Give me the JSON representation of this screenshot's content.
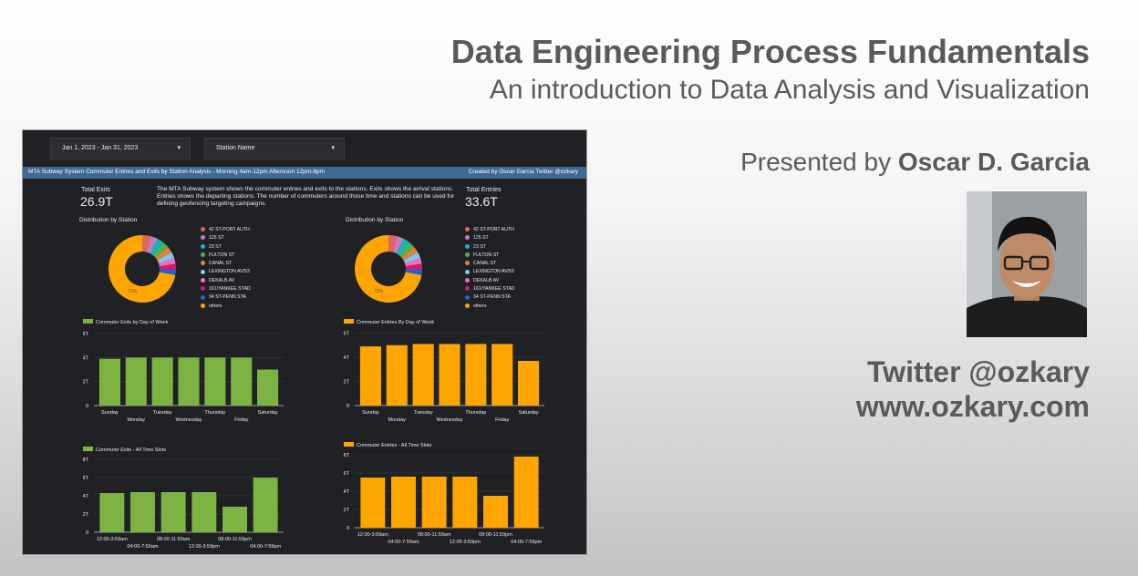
{
  "slide": {
    "title": "Data Engineering Process Fundamentals",
    "subtitle": "An introduction to Data Analysis and Visualization",
    "presented_prefix": "Presented by",
    "presenter": "Oscar D. Garcia",
    "twitter": "Twitter @ozkary",
    "website": "www.ozkary.com"
  },
  "dashboard": {
    "date_filter": "Jan 1, 2023 - Jan 31, 2023",
    "station_filter": "Station Name",
    "dropdown_arrow": "▾",
    "banner_left": "MTA Subway System Commuter Entries and Exits by Station Analysis  -  Morning 4am-12pm Afternoon 12pm-8pm",
    "banner_right": "Created by Oscar Garcia Twitter @ozkary",
    "exits_label": "Total Exits",
    "exits_value": "26.9T",
    "entries_label": "Total Entries",
    "entries_value": "33.6T",
    "description": "The MTA Subway system shows the commuter entries and exits to the stations. Exits shows the arrival stations. Entries shows the departing stations. The number of commuters around those time and stations can be used for defining geofencing targeting campaigns.",
    "distribution_title_left": "Distribution by Station",
    "distribution_title_right": "Distribution by Station",
    "stations": [
      {
        "name": "42 ST-PORT AUTH",
        "color": "#d86b5b"
      },
      {
        "name": "125 ST",
        "color": "#cc79c0"
      },
      {
        "name": "23 ST",
        "color": "#14b8b8"
      },
      {
        "name": "FULTON ST",
        "color": "#55b04a"
      },
      {
        "name": "CANAL ST",
        "color": "#e0823a"
      },
      {
        "name": "LEXINGTON AV/53",
        "color": "#7fc7f0"
      },
      {
        "name": "DEKALB AV",
        "color": "#f070c0"
      },
      {
        "name": "161/YANKEE STAD",
        "color": "#d81b60"
      },
      {
        "name": "34 ST-PENN STA",
        "color": "#1e62d8"
      },
      {
        "name": "others",
        "color": "#ffa500"
      }
    ],
    "colors": {
      "exits": "#7cb342",
      "entries": "#ffa500",
      "banner": "#3f6a94",
      "background": "#202124"
    }
  },
  "chart_data": [
    {
      "type": "pie",
      "title": "Distribution by Station",
      "labels": [
        "42 ST-PORT AUTH",
        "125 ST",
        "23 ST",
        "FULTON ST",
        "CANAL ST",
        "LEXINGTON AV/53",
        "DEKALB AV",
        "161/YANKEE STAD",
        "34 ST-PENN STA",
        "others"
      ],
      "values": [
        4,
        3.5,
        3.2,
        3.1,
        3,
        3,
        2.8,
        2.7,
        2.7,
        72
      ],
      "annotation": "72%"
    },
    {
      "type": "pie",
      "title": "Distribution by Station",
      "labels": [
        "42 ST-PORT AUTH",
        "125 ST",
        "23 ST",
        "FULTON ST",
        "CANAL ST",
        "LEXINGTON AV/53",
        "DEKALB AV",
        "161/YANKEE STAD",
        "34 ST-PENN STA",
        "others"
      ],
      "values": [
        4,
        3.5,
        3.2,
        3.1,
        3,
        3,
        2.8,
        2.7,
        2.7,
        72
      ],
      "annotation": "72%"
    },
    {
      "type": "bar",
      "series": [
        {
          "name": "Commuter Exits by Day of Week",
          "values": [
            3.9,
            4.0,
            4.0,
            4.0,
            4.0,
            4.0,
            3.0
          ]
        }
      ],
      "categories": [
        "Sunday",
        "Monday",
        "Tuesday",
        "Wednesday",
        "Thursday",
        "Friday",
        "Saturday"
      ],
      "ylim": [
        0,
        6
      ],
      "yticks": [
        {
          "v": 0,
          "label": "0"
        },
        {
          "v": 2,
          "label": "2T"
        },
        {
          "v": 4,
          "label": "4T"
        },
        {
          "v": 6,
          "label": "6T"
        }
      ]
    },
    {
      "type": "bar",
      "series": [
        {
          "name": "Commuter Entries By Day of Week",
          "values": [
            4.9,
            5.0,
            5.1,
            5.1,
            5.1,
            5.1,
            3.7
          ]
        }
      ],
      "categories": [
        "Sunday",
        "Monday",
        "Tuesday",
        "Wednesday",
        "Thursday",
        "Friday",
        "Saturday"
      ],
      "ylim": [
        0,
        8
      ],
      "yticks": [
        {
          "v": 0,
          "label": "0"
        },
        {
          "v": 2,
          "label": "2T"
        },
        {
          "v": 4,
          "label": "4T"
        },
        {
          "v": 6,
          "label": "6T"
        }
      ]
    },
    {
      "type": "bar",
      "series": [
        {
          "name": "Commuter Exits - All Time Slots",
          "values": [
            4.3,
            4.4,
            4.4,
            4.4,
            2.8,
            6.0
          ]
        }
      ],
      "categories": [
        "12:00-3:59am",
        "04:00-7:59am",
        "08:00-11:59am",
        "12:00-3:59pm",
        "08:00-11:59pm",
        "04:00-7:59pm"
      ],
      "ylim": [
        0,
        8
      ],
      "yticks": [
        {
          "v": 0,
          "label": "0"
        },
        {
          "v": 2,
          "label": "2T"
        },
        {
          "v": 4,
          "label": "4T"
        },
        {
          "v": 6,
          "label": "6T"
        },
        {
          "v": 8,
          "label": "8T"
        }
      ]
    },
    {
      "type": "bar",
      "series": [
        {
          "name": "Commuter Entries - All Time Slots",
          "values": [
            5.5,
            5.6,
            5.6,
            5.6,
            3.5,
            7.8
          ]
        }
      ],
      "categories": [
        "12:00-3:59am",
        "04:00-7:59am",
        "08:00-11:59am",
        "12:00-3:59pm",
        "08:00-11:59pm",
        "04:00-7:59pm"
      ],
      "ylim": [
        0,
        8
      ],
      "yticks": [
        {
          "v": 0,
          "label": "0"
        },
        {
          "v": 2,
          "label": "2T"
        },
        {
          "v": 4,
          "label": "4T"
        },
        {
          "v": 6,
          "label": "6T"
        },
        {
          "v": 8,
          "label": "8T"
        }
      ]
    }
  ]
}
